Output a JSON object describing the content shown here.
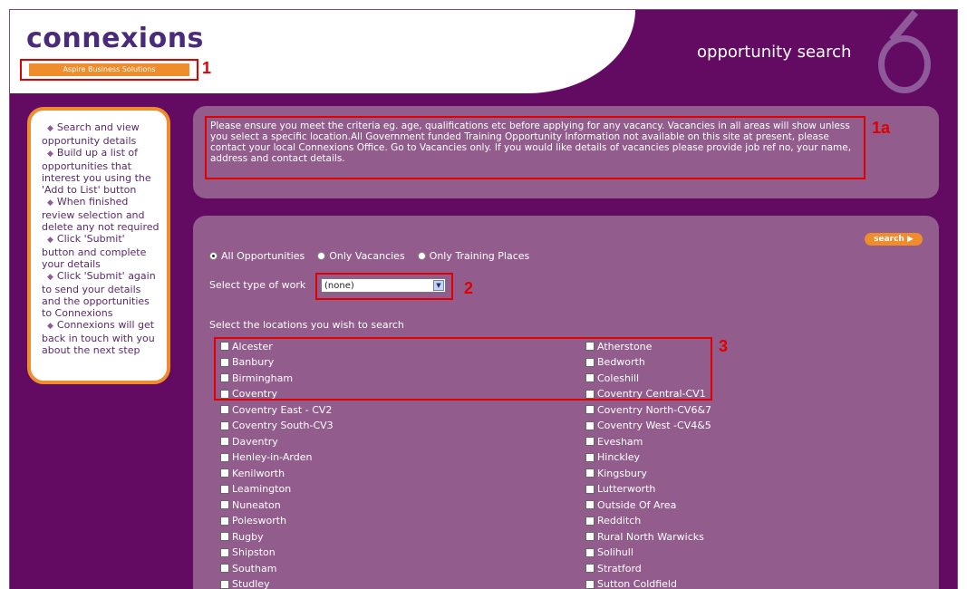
{
  "header": {
    "logo_text": "connexions",
    "tagline": "Aspire Business Solutions",
    "title": "opportunity search"
  },
  "callouts": {
    "c1": "1",
    "c1a": "1a",
    "c2": "2",
    "c3": "3"
  },
  "sidebar": {
    "items": [
      "Search and view opportunity details",
      "Build up a list of opportunities that interest you using the 'Add to List' button",
      "When finished review selection and delete any not required",
      "Click 'Submit' button and complete your details",
      "Click 'Submit' again to send your details and the opportunities to Connexions",
      "Connexions will get back in touch with you about the next step"
    ]
  },
  "notice": {
    "text": "Please ensure you meet the criteria eg. age, qualifications etc before applying for any vacancy. Vacancies in all areas will show unless you select a specific location.All Government funded Training Opportunity Information not available on this site at present, please contact your local Connexions Office. Go to Vacancies only. If you would like details of vacancies please provide job ref no, your name, address and contact details."
  },
  "search": {
    "button_label": "search",
    "radios": [
      {
        "label": "All Opportunities",
        "selected": true
      },
      {
        "label": "Only Vacancies",
        "selected": false
      },
      {
        "label": "Only Training Places",
        "selected": false
      }
    ],
    "work_label": "Select type of work",
    "work_value": "(none)",
    "locations_label": "Select the locations you wish to search",
    "locations_left": [
      "Alcester",
      "Banbury",
      "Birmingham",
      "Coventry",
      "Coventry East - CV2",
      "Coventry South-CV3",
      "Daventry",
      "Henley-in-Arden",
      "Kenilworth",
      "Leamington",
      "Nuneaton",
      "Polesworth",
      "Rugby",
      "Shipston",
      "Southam",
      "Studley"
    ],
    "locations_right": [
      "Atherstone",
      "Bedworth",
      "Coleshill",
      "Coventry Central-CV1",
      "Coventry North-CV6&7",
      "Coventry West -CV4&5",
      "Evesham",
      "Hinckley",
      "Kingsbury",
      "Lutterworth",
      "Outside Of Area",
      "Redditch",
      "Rural North Warwicks",
      "Solihull",
      "Stratford",
      "Sutton Coldfield"
    ]
  }
}
